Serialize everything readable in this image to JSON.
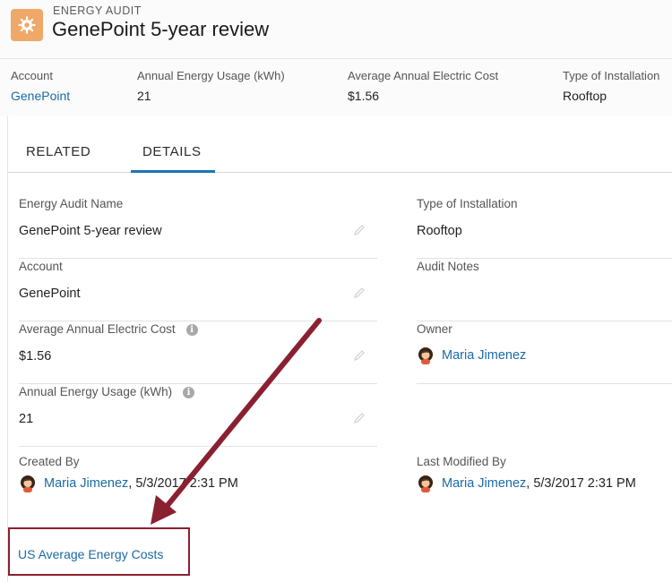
{
  "header": {
    "object_type": "ENERGY AUDIT",
    "title": "GenePoint 5-year review",
    "icon": "gear-icon",
    "icon_color": "#f0a868"
  },
  "highlights": [
    {
      "label": "Account",
      "value": "GenePoint",
      "link": true
    },
    {
      "label": "Annual Energy Usage (kWh)",
      "value": "21",
      "link": false
    },
    {
      "label": "Average Annual Electric Cost",
      "value": "$1.56",
      "link": false
    },
    {
      "label": "Type of Installation",
      "value": "Rooftop",
      "link": false
    }
  ],
  "tabs": [
    {
      "label": "RELATED",
      "active": false
    },
    {
      "label": "DETAILS",
      "active": true
    }
  ],
  "details": {
    "left": [
      {
        "label": "Energy Audit Name",
        "value": "GenePoint 5-year review"
      },
      {
        "label": "Account",
        "value": "GenePoint"
      },
      {
        "label": "Average Annual Electric Cost",
        "value": "$1.56",
        "info": "i"
      },
      {
        "label": "Annual Energy Usage (kWh)",
        "value": "21",
        "info": "i"
      }
    ],
    "right": [
      {
        "label": "Type of Installation",
        "value": "Rooftop"
      },
      {
        "label": "Audit Notes",
        "value": ""
      },
      {
        "label": "Owner",
        "value": "Maria Jimenez"
      }
    ],
    "created_by": {
      "label": "Created By",
      "name": "Maria Jimenez",
      "date": ", 5/3/2017 2:31 PM"
    },
    "last_modified_by": {
      "label": "Last Modified By",
      "name": "Maria Jimenez",
      "date": ", 5/3/2017 2:31 PM"
    }
  },
  "callout": {
    "link": "US Average Energy Costs",
    "color": "#8a2030"
  },
  "colors": {
    "link": "#1a6aa6",
    "tab_active": "#1e73b8"
  }
}
